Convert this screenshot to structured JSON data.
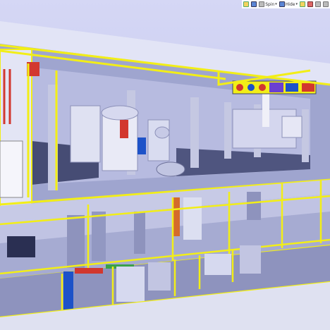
{
  "toolbar": {
    "items": [
      {
        "icon": "orbit-icon",
        "label": ""
      },
      {
        "icon": "refresh-icon",
        "label": ""
      },
      {
        "icon": "spin-icon",
        "label": "Spin"
      },
      {
        "icon": "hide-icon",
        "label": "Hide"
      },
      {
        "icon": "view-cube-icon",
        "label": ""
      },
      {
        "icon": "section-icon",
        "label": ""
      },
      {
        "icon": "camera-icon",
        "label": ""
      },
      {
        "icon": "settings-icon",
        "label": ""
      }
    ]
  },
  "colors": {
    "sky": "#c9ccf2",
    "slab": "#aeb4d6",
    "wall": "#c7cae6",
    "dark": "#3f4468",
    "highlight": "#f2ee17",
    "pipe_red": "#d2372e",
    "pipe_blue": "#1d52c8",
    "equipment": "#d8dcf0"
  }
}
